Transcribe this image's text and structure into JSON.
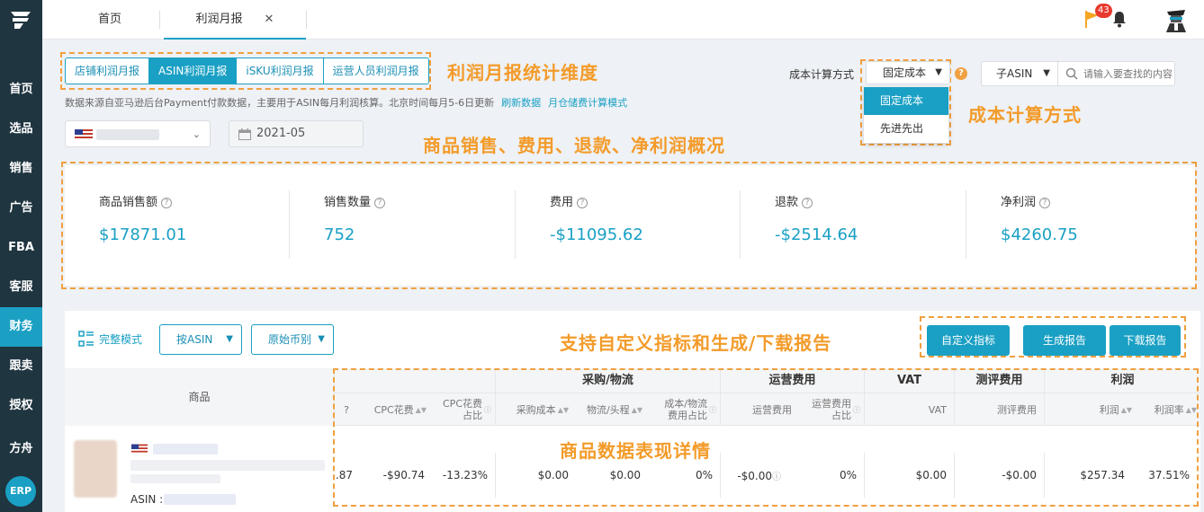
{
  "sidebar": {
    "items": [
      "首页",
      "选品",
      "销售",
      "广告",
      "FBA",
      "客服",
      "财务",
      "跟卖",
      "授权",
      "方舟"
    ],
    "active_index": 6,
    "erp_label": "ERP"
  },
  "topbar": {
    "tabs": [
      {
        "label": "首页"
      },
      {
        "label": "利润月报"
      }
    ],
    "close_glyph": "✕",
    "notification_count": "43"
  },
  "dimensions": {
    "segments": [
      "店铺利润月报",
      "ASIN利润月报",
      "iSKU利润月报",
      "运营人员利润月报"
    ],
    "active_index": 1
  },
  "info": {
    "text": "数据来源自亚马逊后台Payment付款数据，主要用于ASIN每月利润核算。北京时间每月5-6日更新",
    "refresh": "刷新数据",
    "storage": "月仓储费计算模式"
  },
  "filters": {
    "month": "2021-05"
  },
  "cost": {
    "label": "成本计算方式",
    "selected": "固定成本",
    "options": [
      "固定成本",
      "先进先出"
    ],
    "help": "?"
  },
  "search": {
    "scope": "子ASIN",
    "placeholder": "请输入要查找的内容"
  },
  "annotations": {
    "dimension": "利润月报统计维度",
    "cost": "成本计算方式",
    "overview": "商品销售、费用、退款、净利润概况",
    "custom": "支持自定义指标和生成/下载报告",
    "details": "商品数据表现详情"
  },
  "summary": {
    "metrics": [
      {
        "label": "商品销售额",
        "value": "$17871.01"
      },
      {
        "label": "销售数量",
        "value": "752"
      },
      {
        "label": "费用",
        "value": "-$11095.62"
      },
      {
        "label": "退款",
        "value": "-$2514.64"
      },
      {
        "label": "净利润",
        "value": "$4260.75"
      }
    ]
  },
  "toolbar": {
    "mode": "完整模式",
    "group_by": "按ASIN",
    "currency": "原始币别",
    "custom_metrics": "自定义指标",
    "generate_report": "生成报告",
    "download_report": "下载报告"
  },
  "table": {
    "product_header": "商品",
    "groups": [
      "采购/物流",
      "运营费用",
      "VAT",
      "测评费用",
      "利润"
    ],
    "columns": {
      "cpc_cost": "CPC花费",
      "cpc_ratio_1": "CPC花费",
      "cpc_ratio_2": "占比",
      "purchase_cost": "采购成本",
      "shipping": "物流/头程",
      "cost_ratio_1": "成本/物流",
      "cost_ratio_2": "费用占比",
      "ops_cost": "运营费用",
      "ops_ratio_1": "运营费用",
      "ops_ratio_2": "占比",
      "vat": "VAT",
      "review_cost": "测评费用",
      "profit": "利润",
      "margin": "利润率"
    },
    "row": {
      "asin_label": "ASIN :",
      "partial": ".87",
      "cpc_cost": "-$90.74",
      "cpc_ratio": "-13.23%",
      "purchase_cost": "$0.00",
      "shipping": "$0.00",
      "cost_ratio": "0%",
      "ops_cost": "-$0.00",
      "ops_ratio": "0%",
      "vat": "$0.00",
      "review_cost": "-$0.00",
      "profit": "$257.34",
      "margin": "37.51%"
    }
  }
}
